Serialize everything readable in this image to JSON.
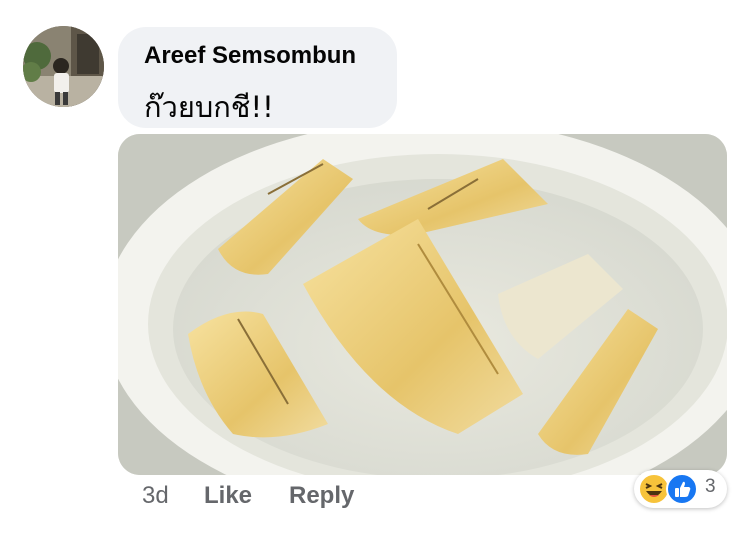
{
  "comment": {
    "author": "Areef Semsombun",
    "text": "ก๊วยบกชี!!"
  },
  "actions": {
    "time": "3d",
    "like_label": "Like",
    "reply_label": "Reply"
  },
  "reactions": {
    "icons": [
      "haha-icon",
      "like-icon"
    ],
    "count": "3"
  },
  "colors": {
    "bubble": "#f0f2f5",
    "like_blue": "#1877f2",
    "haha_yellow": "#f7c33b",
    "meta_gray": "#65676b"
  }
}
